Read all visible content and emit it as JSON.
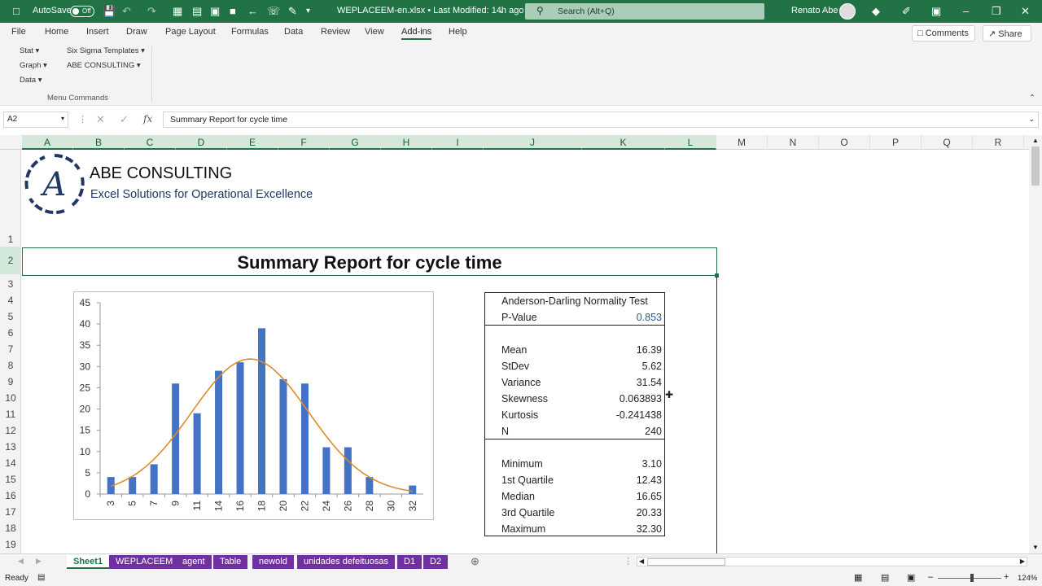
{
  "titlebar": {
    "autosave_label": "AutoSave",
    "autosave_state": "Off",
    "file_title": "WEPLACEEM-en.xlsx • Last Modified: 14h ago",
    "search_placeholder": "Search (Alt+Q)",
    "user_name": "Renato Abe"
  },
  "menu": {
    "items": [
      "File",
      "Home",
      "Insert",
      "Draw",
      "Page Layout",
      "Formulas",
      "Data",
      "Review",
      "View",
      "Add-ins",
      "Help"
    ],
    "active": "Add-ins",
    "comments_label": "Comments",
    "share_label": "Share"
  },
  "ribbon": {
    "stat": "Stat",
    "graph": "Graph",
    "data": "Data",
    "six_sigma": "Six Sigma Templates",
    "abe": "ABE CONSULTING",
    "group_label": "Menu Commands"
  },
  "formula_bar": {
    "name_box": "A2",
    "formula": "Summary Report for cycle time"
  },
  "columns": [
    "A",
    "B",
    "C",
    "D",
    "E",
    "F",
    "G",
    "H",
    "I",
    "J",
    "K",
    "L",
    "M",
    "N",
    "O",
    "P",
    "Q",
    "R"
  ],
  "rows": [
    "1",
    "2",
    "3",
    "4",
    "5",
    "6",
    "7",
    "8",
    "9",
    "10",
    "11",
    "12",
    "13",
    "14",
    "15",
    "16",
    "17",
    "18",
    "19"
  ],
  "logo": {
    "letter": "A",
    "company": "ABE CONSULTING",
    "tagline": "Excel Solutions for Operational Excellence"
  },
  "report": {
    "title": "Summary Report for cycle time",
    "ad_test_title": "Anderson-Darling Normality Test",
    "p_value_label": "P-Value",
    "p_value": "0.853",
    "stats1": [
      {
        "label": "Mean",
        "value": "16.39"
      },
      {
        "label": "StDev",
        "value": "5.62"
      },
      {
        "label": "Variance",
        "value": "31.54"
      },
      {
        "label": "Skewness",
        "value": "0.063893"
      },
      {
        "label": "Kurtosis",
        "value": "-0.241438"
      },
      {
        "label": "N",
        "value": "240"
      }
    ],
    "stats2": [
      {
        "label": "Minimum",
        "value": "3.10"
      },
      {
        "label": "1st Quartile",
        "value": "12.43"
      },
      {
        "label": "Median",
        "value": "16.65"
      },
      {
        "label": "3rd Quartile",
        "value": "20.33"
      },
      {
        "label": "Maximum",
        "value": "32.30"
      }
    ]
  },
  "chart_data": {
    "type": "bar",
    "categories": [
      "3",
      "5",
      "7",
      "9",
      "11",
      "14",
      "16",
      "18",
      "20",
      "22",
      "24",
      "26",
      "28",
      "30",
      "32"
    ],
    "series": [
      {
        "values": [
          4,
          4,
          7,
          26,
          19,
          29,
          31,
          39,
          27,
          26,
          11,
          11,
          4,
          0,
          2
        ]
      }
    ],
    "overlay_curve": {
      "type": "normal-fit",
      "mean": 16.39,
      "stdev": 5.62,
      "color": "#e08a2e"
    },
    "ylim": [
      0,
      45
    ],
    "yticks": [
      0,
      5,
      10,
      15,
      20,
      25,
      30,
      35,
      40,
      45
    ],
    "bar_color": "#4472c4"
  },
  "sheet_tabs": [
    {
      "label": "Sheet1",
      "active": true
    },
    {
      "label": "WEPLACEEM",
      "active": false
    },
    {
      "label": "agent",
      "active": false
    },
    {
      "label": "Table",
      "active": false
    },
    {
      "label": "newold",
      "active": false
    },
    {
      "label": "unidades defeituosas",
      "active": false
    },
    {
      "label": "D1",
      "active": false
    },
    {
      "label": "D2",
      "active": false
    }
  ],
  "status": {
    "ready": "Ready",
    "zoom": "124%"
  },
  "colors": {
    "excel_green": "#217346",
    "tab_purple": "#7030a0",
    "navy": "#1f3864"
  }
}
